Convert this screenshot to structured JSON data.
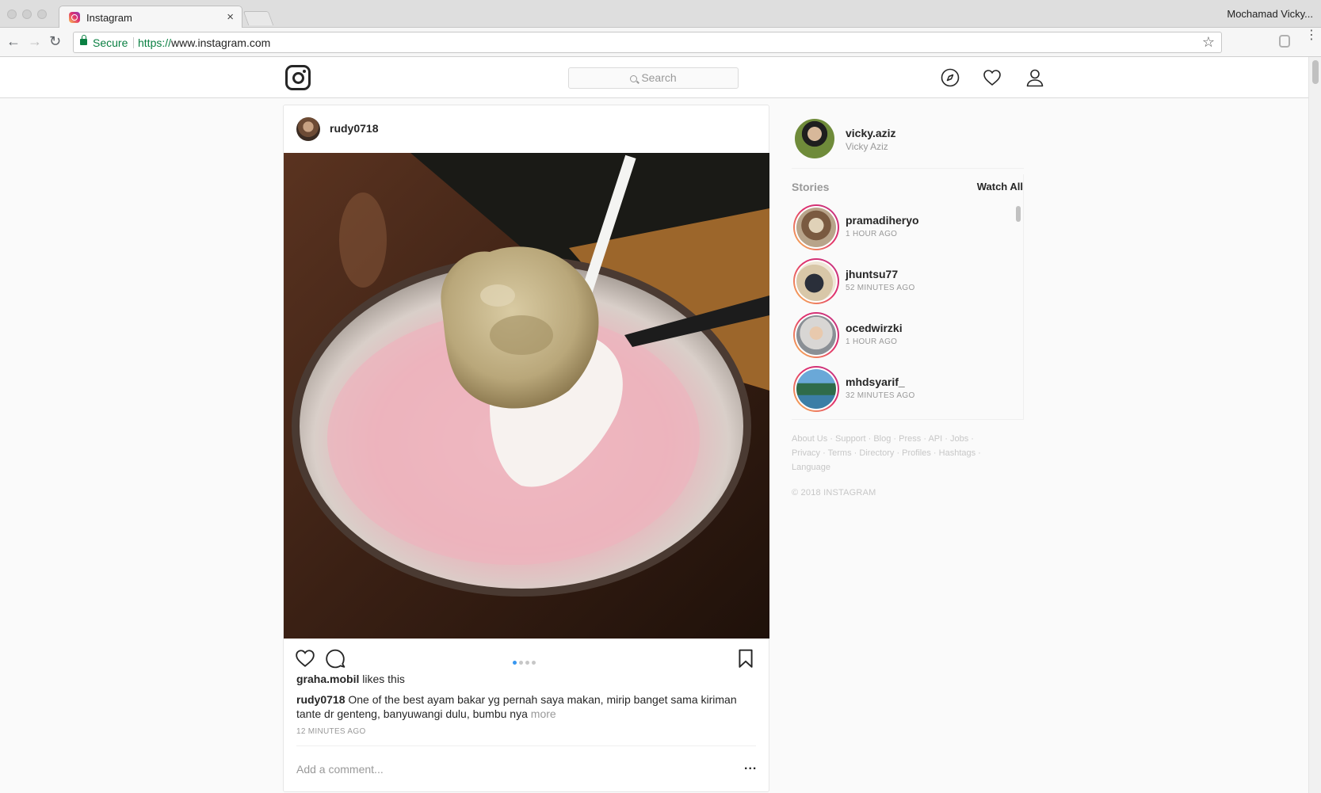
{
  "browser": {
    "tab_title": "Instagram",
    "tab_close": "×",
    "profile_name": "Mochamad Vicky...",
    "secure_label": "Secure",
    "url_scheme": "https://",
    "url_rest": "www.instagram.com",
    "back": "←",
    "forward": "→",
    "reload": "↻",
    "star": "☆",
    "menu": "⋮"
  },
  "header": {
    "search_placeholder": "Search"
  },
  "post": {
    "username": "rudy0718",
    "liked_by": "graha.mobil",
    "likes_suffix": "likes this",
    "caption_user": "rudy0718",
    "caption_text": "One of the best ayam bakar yg pernah saya makan, mirip banget sama kiriman tante dr genteng, banyuwangi dulu, bumbu nya",
    "caption_more": "more",
    "time": "12 MINUTES AGO",
    "comment_placeholder": "Add a comment...",
    "comment_options": "...",
    "carousel": {
      "count": 4,
      "active": 0
    }
  },
  "me": {
    "username": "vicky.aziz",
    "fullname": "Vicky Aziz"
  },
  "stories": {
    "title": "Stories",
    "watch_all": "Watch All",
    "items": [
      {
        "name": "pramadiheryo",
        "time": "1 HOUR AGO"
      },
      {
        "name": "jhuntsu77",
        "time": "52 MINUTES AGO"
      },
      {
        "name": "ocedwirzki",
        "time": "1 HOUR AGO"
      },
      {
        "name": "mhdsyarif_",
        "time": "32 MINUTES AGO"
      }
    ]
  },
  "footer": {
    "links_line1": [
      "About Us",
      "Support",
      "Blog",
      "Press",
      "API",
      "Jobs"
    ],
    "links_line2": [
      "Privacy",
      "Terms",
      "Directory",
      "Profiles",
      "Hashtags"
    ],
    "links_line3": [
      "Language"
    ],
    "copyright": "© 2018 INSTAGRAM"
  },
  "colors": {
    "accent_blue": "#3897f0",
    "secure_green": "#0b8043",
    "story_ring_start": "#f9c154",
    "story_ring_end": "#c13584"
  }
}
